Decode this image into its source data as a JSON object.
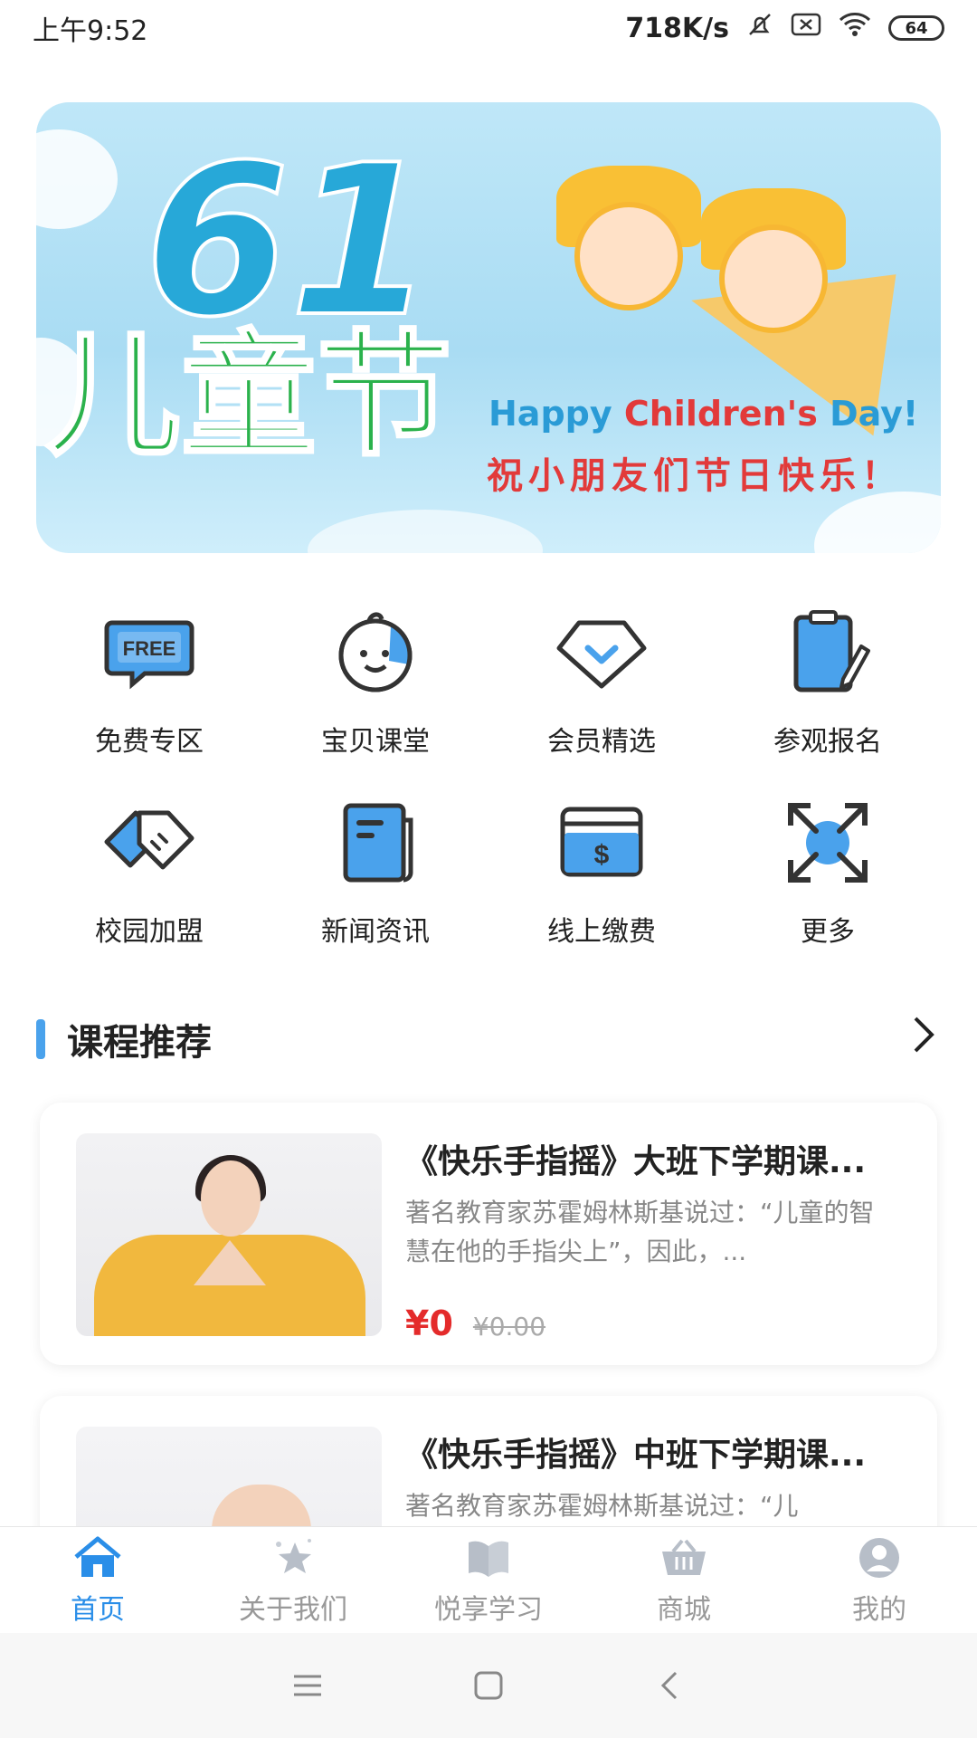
{
  "status_bar": {
    "time": "上午9:52",
    "network_speed": "718K/s",
    "battery": "64"
  },
  "banner": {
    "number": "61",
    "title": "儿童节",
    "subtitle_en_part1": "Happy ",
    "subtitle_en_part2": "Children's",
    "subtitle_en_part3": " Day!",
    "subtitle_cn": "祝小朋友们节日快乐！"
  },
  "grid": {
    "items": [
      {
        "label": "免费专区",
        "icon": "free-icon"
      },
      {
        "label": "宝贝课堂",
        "icon": "baby-face-icon"
      },
      {
        "label": "会员精选",
        "icon": "diamond-icon"
      },
      {
        "label": "参观报名",
        "icon": "clipboard-icon"
      },
      {
        "label": "校园加盟",
        "icon": "handshake-icon"
      },
      {
        "label": "新闻资讯",
        "icon": "newspaper-icon"
      },
      {
        "label": "线上缴费",
        "icon": "payment-card-icon"
      },
      {
        "label": "更多",
        "icon": "expand-icon"
      }
    ],
    "free_badge": "FREE"
  },
  "section": {
    "title": "课程推荐"
  },
  "courses": [
    {
      "title": "《快乐手指摇》大班下学期课...",
      "desc": "著名教育家苏霍姆林斯基说过：“儿童的智慧在他的手指尖上”，因此，...",
      "price": "¥0",
      "original_price": "¥0.00"
    },
    {
      "title": "《快乐手指摇》中班下学期课...",
      "desc": "著名教育家苏霍姆林斯基说过：“儿"
    }
  ],
  "tabbar": {
    "tabs": [
      {
        "label": "首页",
        "icon": "home-icon",
        "active": true
      },
      {
        "label": "关于我们",
        "icon": "star-icon",
        "active": false
      },
      {
        "label": "悦享学习",
        "icon": "book-icon",
        "active": false
      },
      {
        "label": "商城",
        "icon": "basket-icon",
        "active": false
      },
      {
        "label": "我的",
        "icon": "user-icon",
        "active": false
      }
    ]
  },
  "colors": {
    "accent": "#2a8ee8",
    "icon_blue": "#4aa2ec",
    "price_red": "#e42b2b"
  }
}
